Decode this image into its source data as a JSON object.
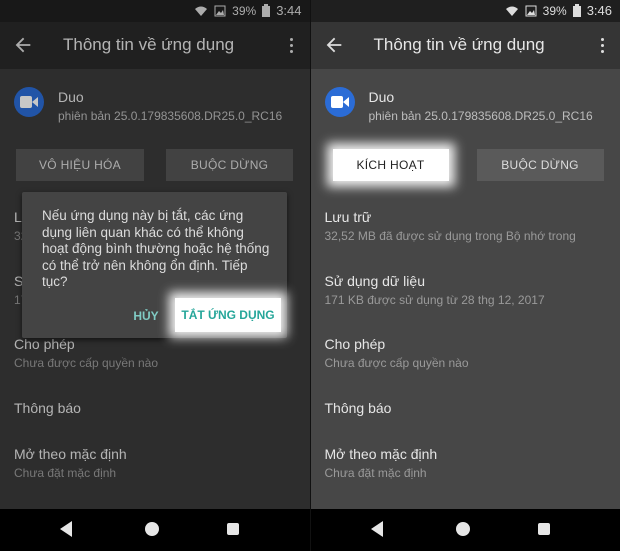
{
  "left": {
    "status": {
      "battery": "39%",
      "time": "3:44"
    },
    "appbar": {
      "title": "Thông tin về ứng dụng"
    },
    "app": {
      "name": "Duo",
      "version": "phiên bản 25.0.179835608.DR25.0_RC16"
    },
    "buttons": {
      "disable": "VÔ HIỆU HÓA",
      "force_stop": "BUỘC DỪNG"
    },
    "partial": {
      "storage_initial": "Lư",
      "storage_sub_initial": "32",
      "data_initial": "S",
      "data_sub_initial": "17"
    },
    "sections": [
      {
        "title": "Cho phép",
        "subtitle": "Chưa được cấp quyền nào"
      },
      {
        "title": "Thông báo",
        "subtitle": ""
      },
      {
        "title": "Mở theo mặc định",
        "subtitle": "Chưa đặt mặc định"
      }
    ],
    "dialog": {
      "message": "Nếu ứng dụng này bị tắt, các ứng dụng liên quan khác có thể không hoạt động bình thường hoặc hệ thống có thể trở nên không ổn định. Tiếp tục?",
      "cancel": "HỦY",
      "confirm": "TẮT ỨNG DỤNG"
    }
  },
  "right": {
    "status": {
      "battery": "39%",
      "time": "3:46"
    },
    "appbar": {
      "title": "Thông tin về ứng dụng"
    },
    "app": {
      "name": "Duo",
      "version": "phiên bản 25.0.179835608.DR25.0_RC16"
    },
    "buttons": {
      "enable": "KÍCH HOẠT",
      "force_stop": "BUỘC DỪNG"
    },
    "sections": [
      {
        "title": "Lưu trữ",
        "subtitle": "32,52 MB đã được sử dụng trong Bộ nhớ trong"
      },
      {
        "title": "Sử dụng dữ liệu",
        "subtitle": "171 KB được sử dụng từ 28 thg 12, 2017"
      },
      {
        "title": "Cho phép",
        "subtitle": "Chưa được cấp quyền nào"
      },
      {
        "title": "Thông báo",
        "subtitle": ""
      },
      {
        "title": "Mở theo mặc định",
        "subtitle": "Chưa đặt mặc định"
      }
    ]
  },
  "colors": {
    "accent": "#26a69a",
    "app_icon": "#2b6cd6",
    "highlight": "#ffffff"
  },
  "icons": [
    "wifi-icon",
    "image-icon",
    "battery-icon",
    "back-arrow-icon",
    "more-vert-icon",
    "duo-video-icon",
    "nav-back-icon",
    "nav-home-icon",
    "nav-recents-icon"
  ]
}
